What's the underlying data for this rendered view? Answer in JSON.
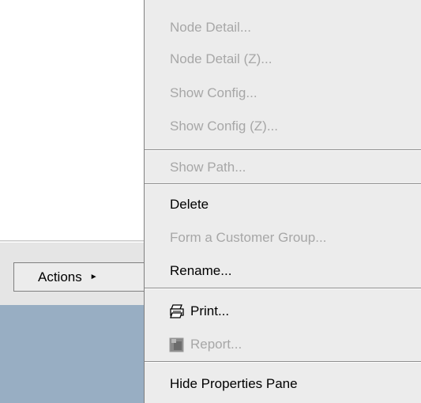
{
  "toolbar": {
    "actions_label": "Actions"
  },
  "menu": {
    "items": [
      {
        "label": "Node Detail...",
        "enabled": false
      },
      {
        "label": "Node Detail (Z)...",
        "enabled": false
      },
      {
        "label": "Show Config...",
        "enabled": false
      },
      {
        "label": "Show Config (Z)...",
        "enabled": false
      },
      {
        "label": "Show Path...",
        "enabled": false
      },
      {
        "label": "Delete",
        "enabled": true
      },
      {
        "label": "Form a Customer Group...",
        "enabled": false
      },
      {
        "label": "Rename...",
        "enabled": true
      },
      {
        "label": "Print...",
        "enabled": true,
        "icon": "printer-icon"
      },
      {
        "label": "Report...",
        "enabled": false,
        "icon": "report-icon"
      },
      {
        "label": "Hide Properties Pane",
        "enabled": true
      }
    ]
  },
  "colors": {
    "menu_bg": "#ececec",
    "disabled_text": "#a7a7a7",
    "panel_blue": "#98aec3"
  }
}
